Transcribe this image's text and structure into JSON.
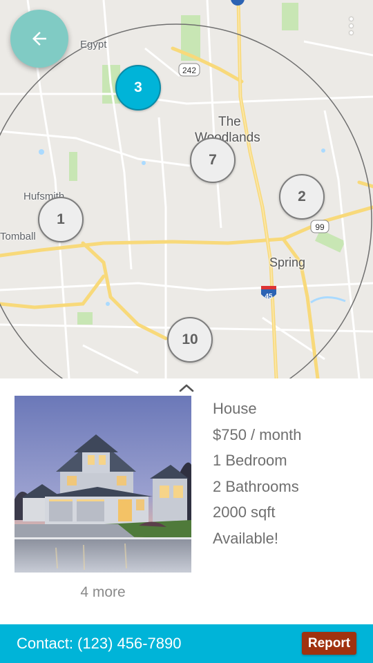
{
  "map": {
    "labels": {
      "egypt": "Egypt",
      "the": "The",
      "woodlands": "Woodlands",
      "hufsmith": "Hufsmith",
      "tomball": "Tomball",
      "spring": "Spring"
    },
    "shields": {
      "road_242": "242",
      "road_99": "99",
      "interstate_45": "45"
    },
    "clusters": [
      {
        "count": "3",
        "selected": true
      },
      {
        "count": "7",
        "selected": false
      },
      {
        "count": "2",
        "selected": false
      },
      {
        "count": "1",
        "selected": false
      },
      {
        "count": "10",
        "selected": false
      }
    ]
  },
  "toolbar": {
    "back_icon": "arrow-back-icon",
    "menu_icon": "more-vert-icon"
  },
  "listing": {
    "type": "House",
    "price": "$750 / month",
    "bedrooms": "1 Bedroom",
    "bathrooms": "2 Bathrooms",
    "area": "2000 sqft",
    "status": "Available!",
    "more_photos": "4 more",
    "expand_icon": "chevron-up-icon"
  },
  "footer": {
    "contact": "Contact: (123) 456-7890",
    "report_label": "Report"
  },
  "colors": {
    "accent": "#00b4d8",
    "back_button": "#80cbc4",
    "report_button": "#a0320f"
  }
}
